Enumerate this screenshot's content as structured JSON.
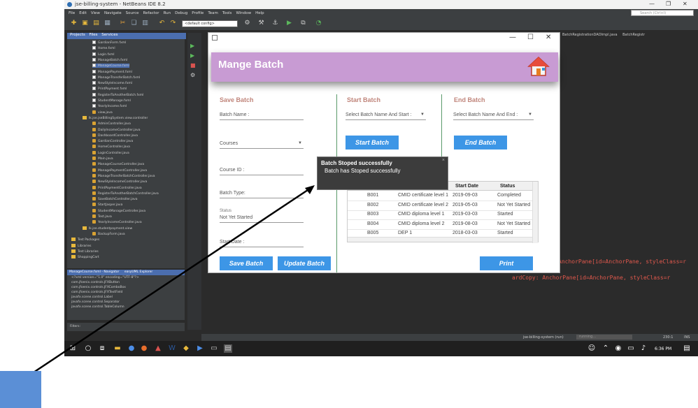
{
  "ide": {
    "title": "jse-billing-system - NetBeans IDE 8.2",
    "menu": [
      "File",
      "Edit",
      "View",
      "Navigate",
      "Source",
      "Refactor",
      "Run",
      "Debug",
      "Profile",
      "Team",
      "Tools",
      "Window",
      "Help"
    ],
    "search_placeholder": "Search (Ctrl+I)",
    "config_value": "<default config>",
    "project_tabs": [
      "Projects",
      "Files",
      "Services"
    ],
    "tree_items": [
      "GardianForm.fxml",
      "Home.fxml",
      "Login.fxml",
      "ManageBatch.fxml",
      "ManageCourse.fxml",
      "ManagePayment.fxml",
      "ManageTransferBatch.fxml",
      "NewStyleIncome.fxml",
      "PrintPayment.fxml",
      "RegisterToAnotherBatch.fxml",
      "StudentManage.fxml",
      "YearlyIncome.fxml",
      "view.java",
      "lk.jse.jseBillingSystem.view.controller",
      "AdminController.java",
      "DailyIncomeController.java",
      "DashboardController.java",
      "GardianController.java",
      "HomeController.java",
      "LoginController.java",
      "Main.java",
      "ManageCourseController.java",
      "ManagePaymentController.java",
      "ManageTransferBatchController.java",
      "NewStyleIncomeController.java",
      "PrintPaymentController.java",
      "RegisterToAnotherBatchController.java",
      "SaveBatchController.java",
      "StartJasper.java",
      "StudentManageController.java",
      "Test.java",
      "YearlyIncomeController.java",
      "lk.jse.studentpayment.view",
      "BackupForm.java",
      "Test Packages",
      "Libraries",
      "Test Libraries",
      "ShoppingCart"
    ],
    "navigator_title": "ManageCourse.fxml - Navigator",
    "navigator_tab2": "easyUML Explorer",
    "navigator_items": [
      "<?xml version=\"1.0\" encoding=\"UTF-8\"?>",
      "com.jfoenix.controls.JFXButton",
      "com.jfoenix.controls.JFXComboBox",
      "com.jfoenix.controls.JFXTextField",
      "javafx.scene.control.Label",
      "javafx.scene.control.Separator",
      "javafx.scene.control.TableColumn"
    ],
    "filters_label": "Filters:",
    "editor_tabs": [
      "BatchRegistrationDAOImpl.java",
      "BatchRegistr"
    ],
    "console_lines": [
      "AnchorPane[id=AnchorPane, styleClass=r",
      "ardCopy: AnchorPane[id=AnchorPane, styleClass=r"
    ],
    "status_project": "jse-billing-system (run)",
    "status_running": "running...",
    "status_pos": "230:1",
    "status_ins": "INS",
    "clock": "6:36 PM"
  },
  "app": {
    "title": "Mange Batch",
    "save_section": "Save Batch",
    "batch_name_placeholder": "Batch Name :",
    "courses_placeholder": "Courses",
    "course_id_placeholder": "Course ID :",
    "batch_type_placeholder": "Batch Type:",
    "status_label": "Status",
    "status_value": "Not Yet Started",
    "start_date_placeholder": "Start Date :",
    "save_button": "Save Batch",
    "update_button": "Update Batch",
    "start_section": "Start Batch",
    "start_select": "Select Batch Name And Start :",
    "start_button": "Start Batch",
    "end_section": "End Batch",
    "end_select": "Select Batch Name And End :",
    "end_button": "End Batch",
    "print_button": "Print",
    "table": {
      "headers": [
        "",
        "",
        "Start Date",
        "Status"
      ],
      "rows": [
        [
          "B001",
          "CMID certificate level 1",
          "2019-09-03",
          "Completed"
        ],
        [
          "B002",
          "CMID certificate level 2",
          "2019-05-03",
          "Not Yet Started"
        ],
        [
          "B003",
          "CMID diploma level 1",
          "2019-03-03",
          "Started"
        ],
        [
          "B004",
          "CMID diploma level 2",
          "2019-08-03",
          "Not Yet Started"
        ],
        [
          "B005",
          "DEP 1",
          "2018-03-03",
          "Started"
        ]
      ]
    }
  },
  "toast": {
    "title": "Batch Stoped successfully",
    "message": "Batch has Stoped successfully"
  },
  "colors": {
    "header": "#c89bd3",
    "button": "#3d96e6",
    "section_title": "#c0857b"
  }
}
